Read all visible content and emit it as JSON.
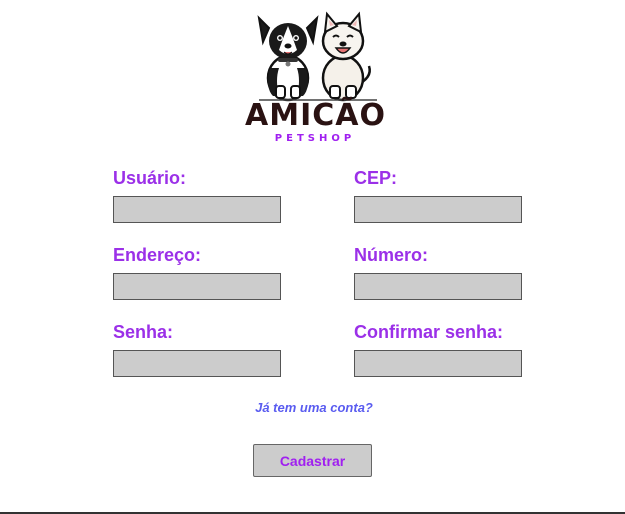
{
  "brand": {
    "name": "AMICÃO",
    "tagline": "PETSHOP",
    "logo_icon": "dogs-logo-icon"
  },
  "form": {
    "user_label": "Usuário:",
    "cep_label": "CEP:",
    "address_label": "Endereço:",
    "number_label": "Número:",
    "password_label": "Senha:",
    "confirm_password_label": "Confirmar senha:",
    "user_value": "",
    "cep_value": "",
    "address_value": "",
    "number_value": "",
    "password_value": "",
    "confirm_password_value": ""
  },
  "login_link": "Já tem uma conta?",
  "submit_label": "Cadastrar",
  "colors": {
    "label": "#9b30e8",
    "link": "#5a5cf0",
    "field": "#cccccc"
  }
}
